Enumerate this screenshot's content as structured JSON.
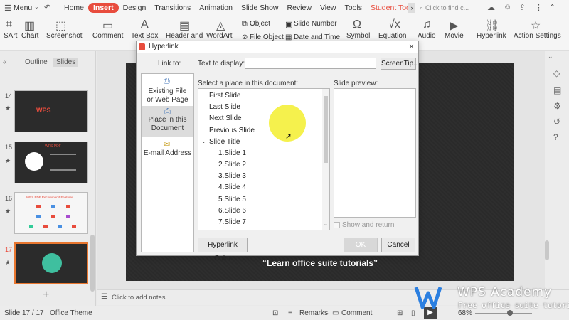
{
  "menubar": {
    "menu_label": "Menu",
    "items": [
      "Home",
      "Insert",
      "Design",
      "Transitions",
      "Animation",
      "Slide Show",
      "Review",
      "View",
      "Tools",
      "Student Tools"
    ],
    "find_placeholder": "Click to find c..."
  },
  "ribbon": {
    "smartart": "SArt",
    "chart": "Chart",
    "screenshot": "Screenshot",
    "comment": "Comment",
    "textbox": "Text Box",
    "header_footer": "Header and",
    "wordart": "WordArt",
    "object": "Object",
    "file_object": "File Object",
    "slide_number": "Slide Number",
    "date_time": "Date and Time",
    "symbol": "Symbol",
    "equation": "Equation",
    "audio": "Audio",
    "movie": "Movie",
    "hyperlink": "Hyperlink",
    "action_settings": "Action Settings"
  },
  "leftpanel": {
    "tab_outline": "Outline",
    "tab_slides": "Slides",
    "slide_numbers": [
      "14",
      "15",
      "16",
      "17"
    ],
    "thumb14_text": "WPS",
    "thumb15_text": "WPS PDF",
    "thumb16_text": "WPS PDF Recommend Features",
    "add_slide": "+"
  },
  "slide": {
    "caption": "“Learn office suite tutorials”"
  },
  "notes": {
    "placeholder": "Click to add notes"
  },
  "statusbar": {
    "slide_info": "Slide 17 / 17",
    "theme": "Office Theme",
    "remarks": "Remarks",
    "comment": "Comment",
    "zoom": "68%"
  },
  "watermark": {
    "title": "WPS Academy",
    "subtitle": "Free office suite tutorials"
  },
  "dialog": {
    "title": "Hyperlink",
    "link_to_label": "Link to:",
    "text_to_display_label": "Text to display:",
    "text_to_display_value": "",
    "screentip_button": "ScreenTip...",
    "link_to_items": [
      {
        "line1": "Existing File",
        "line2": "or Web Page"
      },
      {
        "line1": "Place in this",
        "line2": "Document"
      },
      {
        "line1": "E-mail Address",
        "line2": ""
      }
    ],
    "select_place_label": "Select a place in this document:",
    "places": [
      "First Slide",
      "Last Slide",
      "Next Slide",
      "Previous Slide",
      "Slide Title"
    ],
    "slides": [
      "1.Slide 1",
      "2.Slide 2",
      "3.Slide 3",
      "4.Slide 4",
      "5.Slide 5",
      "6.Slide 6",
      "7.Slide 7"
    ],
    "slide_preview_label": "Slide preview:",
    "show_and_return_label": "Show and return",
    "hyperlink_color_button": "Hyperlink Color",
    "ok_button": "OK",
    "cancel_button": "Cancel"
  }
}
